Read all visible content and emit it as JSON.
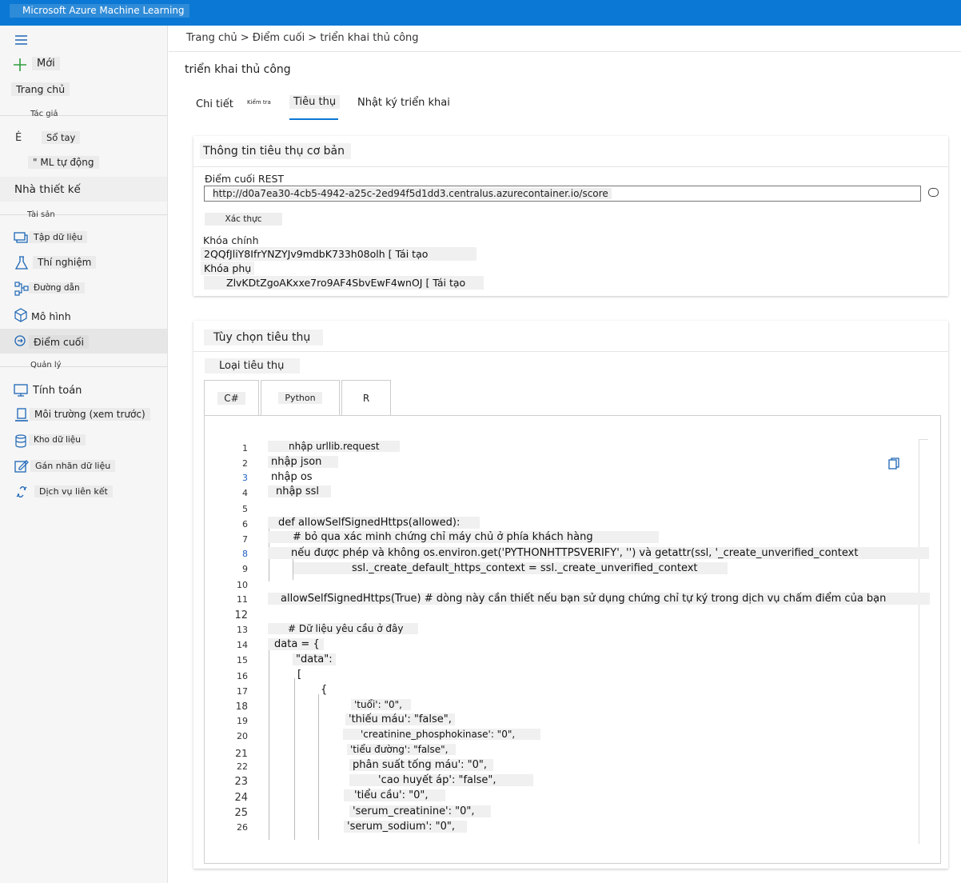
{
  "app": {
    "title": "Microsoft Azure Machine Learning"
  },
  "sidebar": {
    "new_label": "Mới",
    "home_label": "Trang chủ",
    "section_author": "Tác giả",
    "notebooks_label": "Sổ tay",
    "notebooks_prefix": "Ė",
    "automl_label": "\" ML tự động",
    "designer_label": "Nhà thiết kế",
    "section_assets": "Tài sản",
    "datasets_label": "Tập dữ liệu",
    "experiments_label": "Thí nghiệm",
    "pipelines_label": "Đường dẫn",
    "models_label": "Mô hình",
    "endpoints_label": "Điểm cuối",
    "section_manage": "Quản lý",
    "compute_label": "Tính toán",
    "environments_label": "Môi trường (xem trước)",
    "datastores_label": "Kho dữ liệu",
    "labeling_label": "Gán nhãn dữ liệu",
    "linked_services_label": "Dịch vụ liên kết"
  },
  "breadcrumb": "Trang chủ > Điểm cuối > triển khai thủ công",
  "page_title": "triển khai thủ công",
  "tabs": {
    "details": "Chi tiết",
    "test": "Kiểm tra",
    "consume": "Tiêu thụ",
    "logs": "Nhật ký triển khai"
  },
  "basic_info": {
    "title": "Thông tin tiêu thụ cơ bản",
    "rest_label": "Điểm cuối REST",
    "rest_url": "http://d0a7ea30-4cb5-4942-a25c-2ed94f5d1dd3.centralus.azurecontainer.io/score",
    "auth_label": "Xác thực",
    "primary_label": "Khóa chính",
    "primary_key": "2QQfJliY8IfrYNZYJv9mdbK733h08olh [ Tái tạo",
    "secondary_label": "Khóa phụ",
    "secondary_key": "ZlvKDtZgoAKxxe7ro9AF4SbvEwF4wnOJ [ Tái tạo"
  },
  "consume_options": {
    "title": "Tùy chọn tiêu thụ",
    "type_label": "Loại tiêu thụ",
    "lang_tabs": [
      "C#",
      "Python",
      "R"
    ]
  },
  "code_lines": [
    "nhập urllib.request",
    "nhập json",
    "nhập os",
    "nhập ssl",
    "",
    "def allowSelfSignedHttps(allowed):",
    "# bỏ qua xác minh chứng chỉ máy chủ ở phía khách hàng",
    "nếu được phép và không os.environ.get('PYTHONHTTPSVERIFY', '') và getattr(ssl, '_create_unverified_context",
    "ssl._create_default_https_context = ssl._create_unverified_context",
    "",
    "allowSelfSignedHttps(True) # dòng này cần thiết nếu bạn sử dụng chứng chỉ tự ký trong dịch vụ chấm điểm của bạn",
    "",
    "# Dữ liệu yêu cầu ở đây",
    "data = {",
    "\"data\":",
    "[",
    "{",
    "'tuổi': \"0\",",
    "'thiếu máu': \"false\",",
    "'creatinine_phosphokinase': \"0\",",
    "'tiểu đường': \"false\",",
    "phân suất tống máu': \"0\",",
    "'cao huyết áp': \"false\",",
    "'tiểu cầu': \"0\",",
    "'serum_creatinine': \"0\",",
    "'serum_sodium': \"0\","
  ],
  "line_numbers": [
    "1",
    "2",
    "3",
    "4",
    "5",
    "6",
    "7",
    "8",
    "9",
    "10",
    "11",
    "12",
    "13",
    "14",
    "15",
    "16",
    "17",
    "18",
    "19",
    "20",
    "21",
    "22",
    "23",
    "24",
    "25",
    "26"
  ]
}
